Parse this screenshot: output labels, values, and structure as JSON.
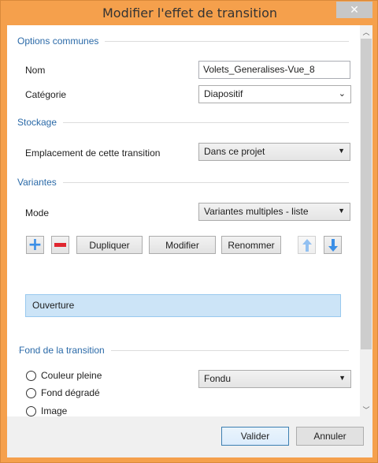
{
  "window": {
    "title": "Modifier l'effet de transition",
    "close_glyph": "✕"
  },
  "sections": {
    "common": "Options communes",
    "storage": "Stockage",
    "variants": "Variantes",
    "background": "Fond de la transition"
  },
  "fields": {
    "name_label": "Nom",
    "name_value": "Volets_Generalises-Vue_8",
    "category_label": "Catégorie",
    "category_value": "Diapositif",
    "location_label": "Emplacement de cette transition",
    "location_value": "Dans ce projet",
    "mode_label": "Mode",
    "mode_value": "Variantes multiples - liste"
  },
  "variant_toolbar": {
    "add_glyph": "+",
    "duplicate": "Dupliquer",
    "modify": "Modifier",
    "rename": "Renommer"
  },
  "variant_list": {
    "item": "Ouverture"
  },
  "background": {
    "options": [
      "Couleur pleine",
      "Fond dégradé",
      "Image"
    ],
    "fade_value": "Fondu"
  },
  "footer": {
    "ok": "Valider",
    "cancel": "Annuler"
  },
  "colors": {
    "frame": "#f5a04c",
    "section_heading": "#2b6aa8",
    "add_icon": "#3a8ee6",
    "remove_icon": "#e0262f",
    "arrow_icon": "#3a8ee6",
    "selection": "#cce4f7"
  }
}
